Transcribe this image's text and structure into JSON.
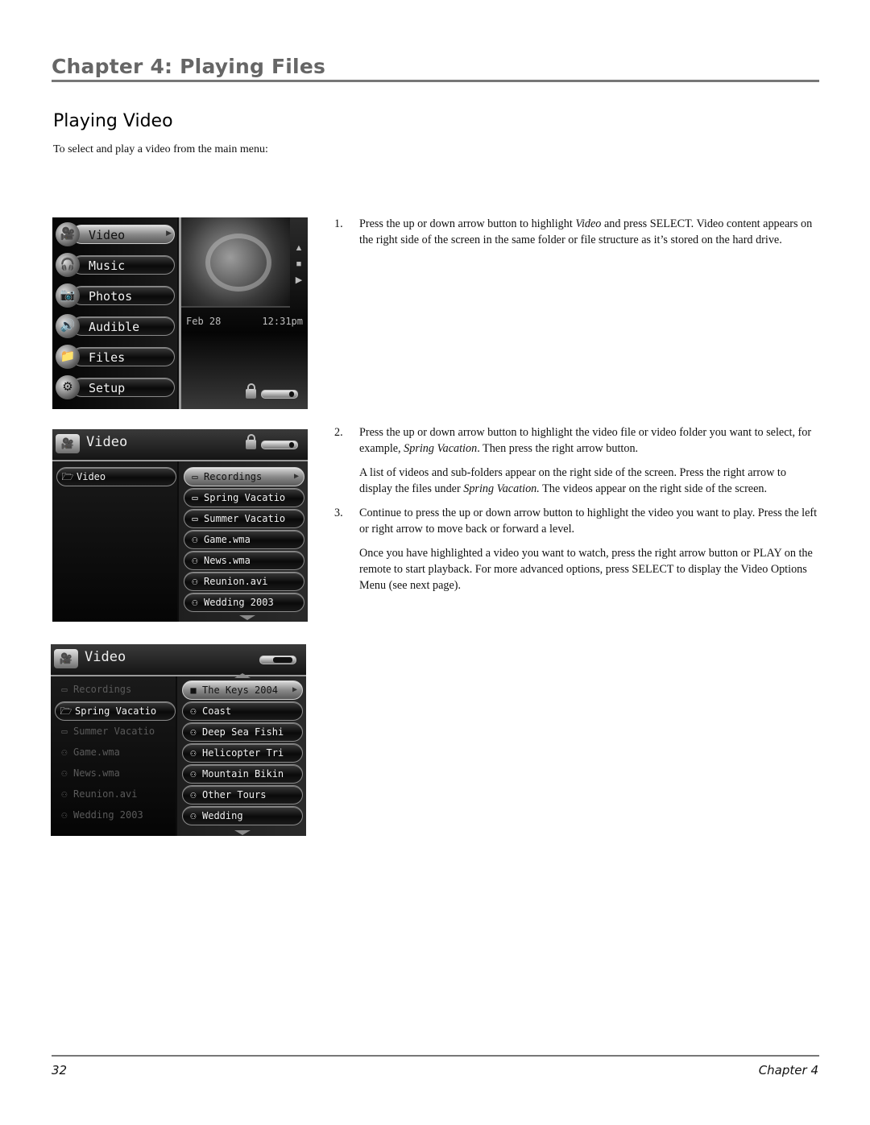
{
  "header": {
    "chapter_title": "Chapter 4: Playing Files",
    "section_title": "Playing Video",
    "intro": "To select and play a video from the main menu:"
  },
  "steps": [
    {
      "number": "1.",
      "paragraphs": [
        {
          "before": "Press the up or down arrow button to highlight ",
          "em": "Video",
          "after": " and press SELECT. Video content appears on the right side of the screen in the same folder or file structure as it’s stored on the hard drive."
        }
      ]
    },
    {
      "number": "2.",
      "paragraphs": [
        {
          "before": "Press the up or down arrow button to highlight the video file or video folder you want to select, for example, ",
          "em": "Spring Vacation",
          "after": ". Then press the right arrow button."
        },
        {
          "before": "A list of videos and sub-folders appear on the right side of the screen. Press the right arrow to display the files under ",
          "em": "Spring Vacation.",
          "after": " The videos appear on the right side of the screen."
        }
      ]
    },
    {
      "number": "3.",
      "paragraphs": [
        {
          "before": "Continue to press the up or down arrow button to highlight the video you want to play. Press the left or right arrow to move back or forward a level.",
          "em": "",
          "after": ""
        },
        {
          "before": "Once you have highlighted a video you want to watch, press the right arrow button or PLAY on the remote to start playback. For more advanced options, press SELECT to display the Video Options Menu (see next page).",
          "em": "",
          "after": ""
        }
      ]
    }
  ],
  "screen1": {
    "menu": [
      {
        "label": "Video",
        "icon": "camcorder-icon",
        "glyph": "🎥",
        "highlighted": true
      },
      {
        "label": "Music",
        "icon": "headphones-icon",
        "glyph": "🎧",
        "highlighted": false
      },
      {
        "label": "Photos",
        "icon": "camera-icon",
        "glyph": "📷",
        "highlighted": false
      },
      {
        "label": "Audible",
        "icon": "speaker-icon",
        "glyph": "🔊",
        "highlighted": false
      },
      {
        "label": "Files",
        "icon": "files-icon",
        "glyph": "📁",
        "highlighted": false
      },
      {
        "label": "Setup",
        "icon": "setup-icon",
        "glyph": "⚙",
        "highlighted": false
      }
    ],
    "date": "Feb 28",
    "time": "12:31pm",
    "side_icons": [
      "▲",
      "■",
      "▶"
    ],
    "battery_level": 0.9
  },
  "screen2": {
    "title": "Video",
    "battery_level": 0.9,
    "left": [
      {
        "label": "Video",
        "icon": "open-folder-icon",
        "glyph": "🗁"
      }
    ],
    "right": [
      {
        "label": "Recordings",
        "icon": "folder-icon",
        "glyph": "▭",
        "highlighted": true
      },
      {
        "label": "Spring Vacatio",
        "icon": "folder-icon",
        "glyph": "▭",
        "highlighted": false
      },
      {
        "label": "Summer Vacatio",
        "icon": "folder-icon",
        "glyph": "▭",
        "highlighted": false
      },
      {
        "label": "Game.wma",
        "icon": "film-camera-icon",
        "glyph": "⚇",
        "highlighted": false
      },
      {
        "label": "News.wma",
        "icon": "film-camera-icon",
        "glyph": "⚇",
        "highlighted": false
      },
      {
        "label": "Reunion.avi",
        "icon": "film-camera-icon",
        "glyph": "⚇",
        "highlighted": false
      },
      {
        "label": "Wedding 2003",
        "icon": "film-camera-icon",
        "glyph": "⚇",
        "highlighted": false
      }
    ]
  },
  "screen3": {
    "title": "Video",
    "battery_level": 0.4,
    "left": [
      {
        "label": "Recordings",
        "icon": "folder-icon",
        "glyph": "▭",
        "active": false
      },
      {
        "label": "Spring Vacatio",
        "icon": "open-folder-icon",
        "glyph": "🗁",
        "active": true
      },
      {
        "label": "Summer Vacatio",
        "icon": "folder-icon",
        "glyph": "▭",
        "active": false
      },
      {
        "label": "Game.wma",
        "icon": "film-camera-icon",
        "glyph": "⚇",
        "active": false
      },
      {
        "label": "News.wma",
        "icon": "film-camera-icon",
        "glyph": "⚇",
        "active": false
      },
      {
        "label": "Reunion.avi",
        "icon": "film-camera-icon",
        "glyph": "⚇",
        "active": false
      },
      {
        "label": "Wedding 2003",
        "icon": "film-camera-icon",
        "glyph": "⚇",
        "active": false
      }
    ],
    "right": [
      {
        "label": "The Keys 2004",
        "icon": "folder-icon",
        "glyph": "■",
        "highlighted": true
      },
      {
        "label": "Coast",
        "icon": "film-camera-icon",
        "glyph": "⚇",
        "highlighted": false
      },
      {
        "label": "Deep Sea Fishi",
        "icon": "film-camera-icon",
        "glyph": "⚇",
        "highlighted": false
      },
      {
        "label": "Helicopter Tri",
        "icon": "film-camera-icon",
        "glyph": "⚇",
        "highlighted": false
      },
      {
        "label": "Mountain Bikin",
        "icon": "film-camera-icon",
        "glyph": "⚇",
        "highlighted": false
      },
      {
        "label": "Other Tours",
        "icon": "film-camera-icon",
        "glyph": "⚇",
        "highlighted": false
      },
      {
        "label": "Wedding",
        "icon": "film-camera-icon",
        "glyph": "⚇",
        "highlighted": false
      }
    ]
  },
  "footer": {
    "page_number": "32",
    "chapter_label": "Chapter 4"
  }
}
